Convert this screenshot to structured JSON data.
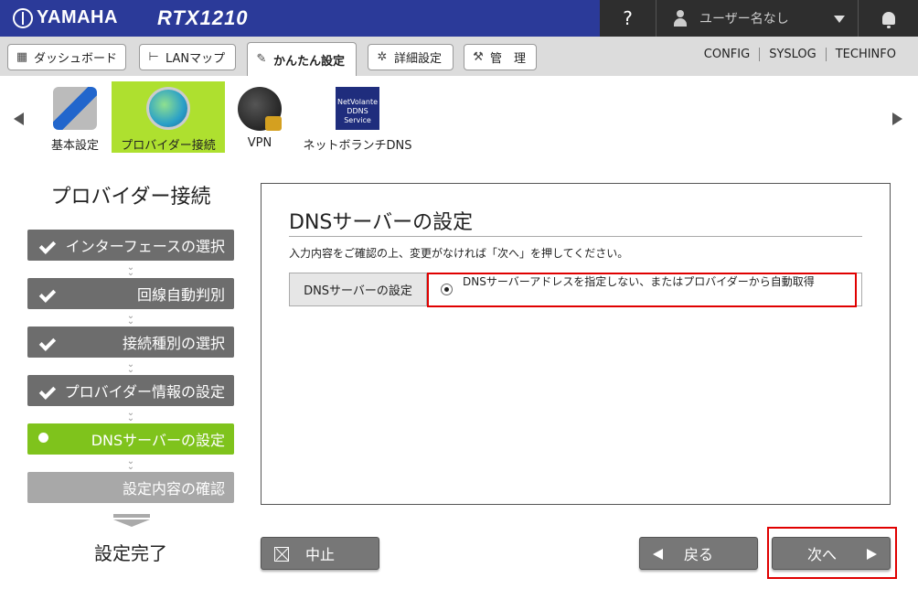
{
  "header": {
    "brand": "YAMAHA",
    "model": "RTX1210",
    "help_label": "?",
    "user_label": "ユーザー名なし"
  },
  "tabs": [
    {
      "label": "ダッシュボード",
      "icon": "dashboard-icon"
    },
    {
      "label": "LANマップ",
      "icon": "lan-map-icon"
    },
    {
      "label": "かんたん設定",
      "icon": "wand-icon",
      "active": true
    },
    {
      "label": "詳細設定",
      "icon": "gear-icon"
    },
    {
      "label": "管　理",
      "icon": "wrench-icon"
    }
  ],
  "sys_links": [
    "CONFIG",
    "SYSLOG",
    "TECHINFO"
  ],
  "wizards": [
    {
      "label": "基本設定",
      "icon": "tools-icon"
    },
    {
      "label": "プロバイダー接続",
      "icon": "globe-icon",
      "active": true
    },
    {
      "label": "VPN",
      "icon": "vpn-lock-icon"
    },
    {
      "label": "ネットボランチDNS",
      "icon": "ddns-icon",
      "icon_text": "NetVolante DDNS Service"
    }
  ],
  "steps_panel": {
    "title": "プロバイダー接続",
    "steps": [
      {
        "label": "インターフェースの選択",
        "state": "done"
      },
      {
        "label": "回線自動判別",
        "state": "done"
      },
      {
        "label": "接続種別の選択",
        "state": "done"
      },
      {
        "label": "プロバイダー情報の設定",
        "state": "done"
      },
      {
        "label": "DNSサーバーの設定",
        "state": "current"
      },
      {
        "label": "設定内容の確認",
        "state": "todo"
      }
    ],
    "done_label": "設定完了"
  },
  "main": {
    "title": "DNSサーバーの設定",
    "description": "入力内容をご確認の上、変更がなければ「次へ」を押してください。",
    "setting_label": "DNSサーバーの設定",
    "setting_value": "DNSサーバーアドレスを指定しない、またはプロバイダーから自動取得"
  },
  "buttons": {
    "cancel": "中止",
    "back": "戻る",
    "next": "次へ"
  },
  "colors": {
    "header_blue": "#2b3a99",
    "header_dark": "#2e2e2e",
    "active_green": "#aee02f",
    "step_current": "#7fc31c",
    "step_done": "#6d6d6d",
    "highlight_red": "#e00000"
  }
}
